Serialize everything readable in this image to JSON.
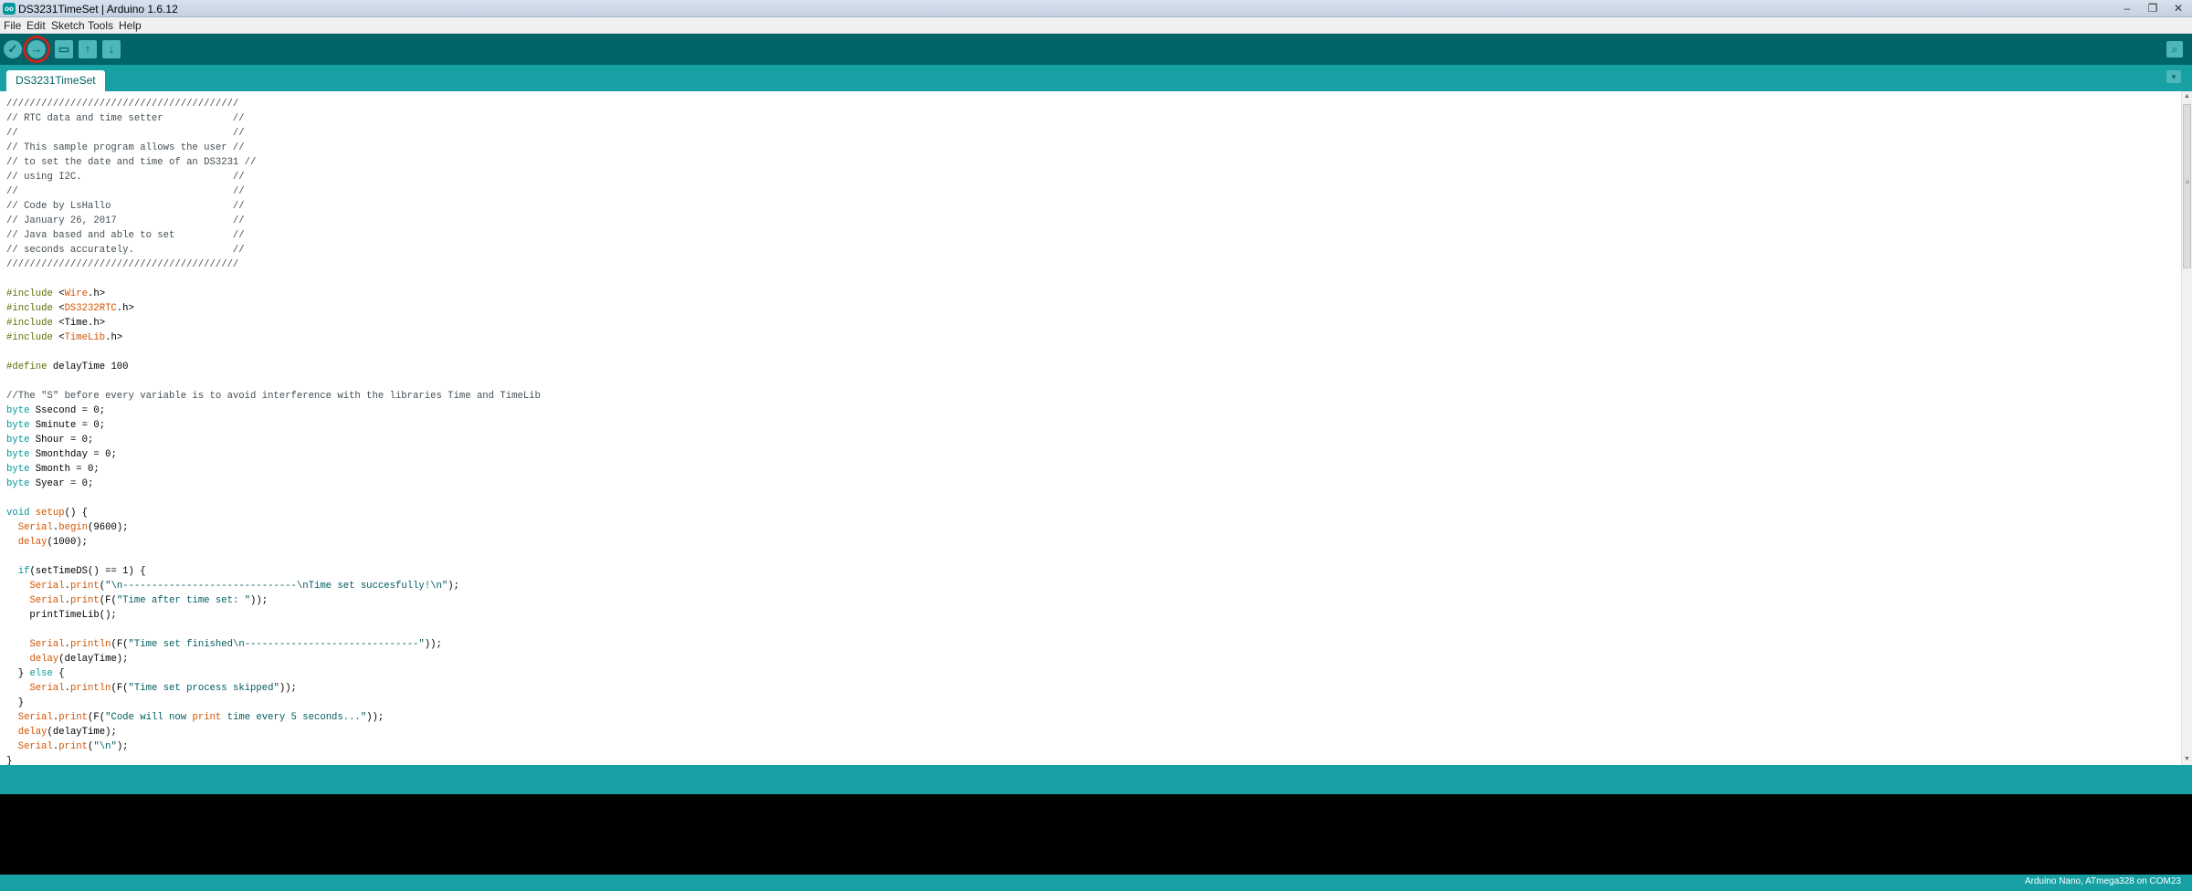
{
  "window": {
    "title": "DS3231TimeSet | Arduino 1.6.12",
    "app_icon_label": "oo",
    "controls": [
      "–",
      "❐",
      "✕"
    ]
  },
  "menu": [
    "File",
    "Edit",
    "Sketch",
    "Tools",
    "Help"
  ],
  "toolbar": {
    "verify": "✓",
    "upload": "→",
    "new": "▭",
    "open": "↑",
    "save": "↓",
    "serial_monitor": "⌕"
  },
  "tabs": [
    {
      "label": "DS3231TimeSet"
    }
  ],
  "tab_menu": "▾",
  "code": [
    "////////////////////////////////////////",
    "// RTC data and time setter            //",
    "//                                     //",
    "// This sample program allows the user //",
    "// to set the date and time of an DS3231 //",
    "// using I2C.                          //",
    "//                                     //",
    "// Code by LsHallo                     //",
    "// January 26, 2017                    //",
    "// Java based and able to set          //",
    "// seconds accurately.                 //",
    "////////////////////////////////////////",
    "",
    "#include <Wire.h>",
    "#include <DS3232RTC.h>",
    "#include <Time.h>",
    "#include <TimeLib.h>",
    "",
    "#define delayTime 100",
    "",
    "//The \"S\" before every variable is to avoid interference with the libraries Time and TimeLib",
    "byte Ssecond = 0;",
    "byte Sminute = 0;",
    "byte Shour = 0;",
    "byte Smonthday = 0;",
    "byte Smonth = 0;",
    "byte Syear = 0;",
    "",
    "void setup() {",
    "  Serial.begin(9600);",
    "  delay(1000);",
    "",
    "  if(setTimeDS() == 1) {",
    "    Serial.print(\"\\n------------------------------\\nTime set succesfully!\\n\");",
    "    Serial.print(F(\"Time after time set: \"));",
    "    printTimeLib();",
    "",
    "    Serial.println(F(\"Time set finished\\n------------------------------\"));",
    "    delay(delayTime);",
    "  } else {",
    "    Serial.println(F(\"Time set process skipped\"));",
    "  }",
    "  Serial.print(F(\"Code will now print time every 5 seconds...\"));",
    "  delay(delayTime);",
    "  Serial.print(\"\\n\");",
    "}"
  ],
  "scrollbar": {
    "up": "▲",
    "down": "▼",
    "grip": "≡"
  },
  "status": {
    "board": "Arduino Nano, ATmega328 on COM23"
  }
}
